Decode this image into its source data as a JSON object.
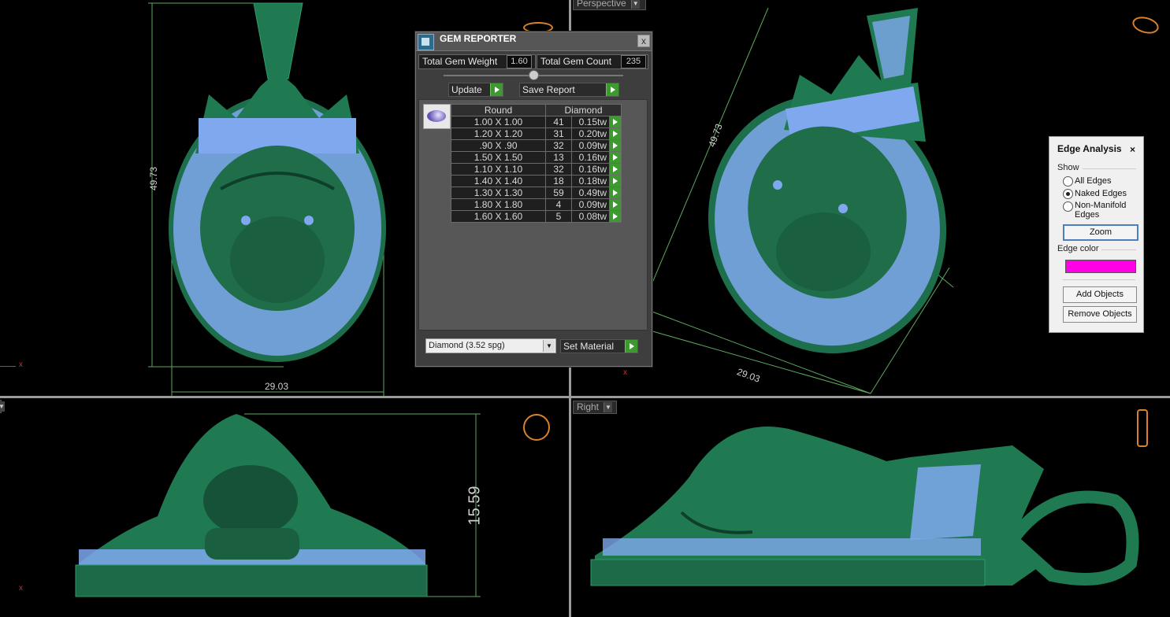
{
  "viewports": {
    "top_left": {
      "dim_vertical": "49.73",
      "dim_horizontal": "29.03"
    },
    "top_right": {
      "label": "Perspective",
      "dim_diagonal": "49.73",
      "dim_horizontal": "29.03"
    },
    "bottom_left": {
      "dim_vertical": "15.59"
    },
    "bottom_right": {
      "label": "Right"
    }
  },
  "gem_reporter": {
    "title": "GEM REPORTER",
    "close_label": "x",
    "total_weight_label": "Total Gem Weight",
    "total_weight_value": "1.60",
    "total_count_label": "Total Gem Count",
    "total_count_value": "235",
    "update_label": "Update",
    "save_report_label": "Save Report",
    "col_shape": "Round",
    "col_material": "Diamond",
    "rows": [
      {
        "size": "1.00 X 1.00",
        "count": "41",
        "weight": "0.15tw"
      },
      {
        "size": "1.20 X 1.20",
        "count": "31",
        "weight": "0.20tw"
      },
      {
        "size": ".90 X .90",
        "count": "32",
        "weight": "0.09tw"
      },
      {
        "size": "1.50 X 1.50",
        "count": "13",
        "weight": "0.16tw"
      },
      {
        "size": "1.10 X 1.10",
        "count": "32",
        "weight": "0.16tw"
      },
      {
        "size": "1.40 X 1.40",
        "count": "18",
        "weight": "0.18tw"
      },
      {
        "size": "1.30 X 1.30",
        "count": "59",
        "weight": "0.49tw"
      },
      {
        "size": "1.80 X 1.80",
        "count": "4",
        "weight": "0.09tw"
      },
      {
        "size": "1.60 X 1.60",
        "count": "5",
        "weight": "0.08tw"
      }
    ],
    "material_select": "Diamond    (3.52 spg)",
    "set_material_label": "Set Material"
  },
  "edge_analysis": {
    "title": "Edge Analysis",
    "close_label": "×",
    "show_label": "Show",
    "options": [
      {
        "label": "All Edges",
        "selected": false
      },
      {
        "label": "Naked Edges",
        "selected": true
      },
      {
        "label": "Non-Manifold Edges",
        "selected": false
      }
    ],
    "zoom_label": "Zoom",
    "edge_color_label": "Edge color",
    "edge_color": "#ff00e6",
    "add_objects_label": "Add Objects",
    "remove_objects_label": "Remove Objects"
  },
  "colors": {
    "model_green": "#1f7a52",
    "gem_blue": "#7fa8ee",
    "background": "#000000"
  }
}
